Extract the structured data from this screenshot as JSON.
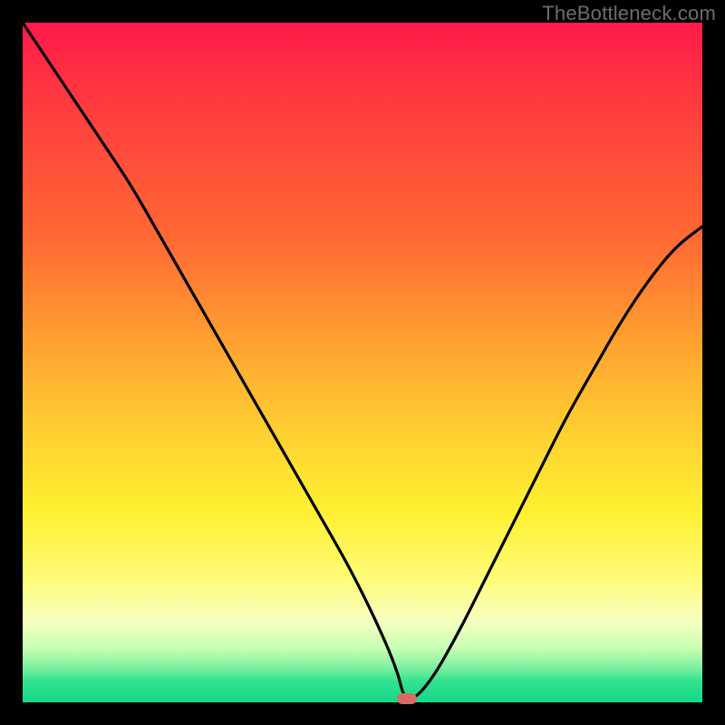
{
  "watermark": "TheBottleneck.com",
  "colors": {
    "frame": "#000000",
    "curve": "#000000",
    "marker": "#d86b64"
  },
  "chart_data": {
    "type": "line",
    "title": "",
    "xlabel": "",
    "ylabel": "",
    "xlim": [
      0,
      100
    ],
    "ylim": [
      0,
      100
    ],
    "grid": false,
    "legend": false,
    "note": "Background vertical gradient encodes severity (red=high, green=low). Curve shows bottleneck % vs. component balance; minimum marks optimal match.",
    "series": [
      {
        "name": "bottleneck-curve",
        "x": [
          0,
          4,
          8,
          12,
          16,
          20,
          24,
          28,
          32,
          36,
          40,
          44,
          48,
          52,
          55,
          56,
          57,
          60,
          64,
          68,
          72,
          76,
          80,
          84,
          88,
          92,
          96,
          100
        ],
        "values": [
          100,
          94,
          88,
          82,
          76,
          69,
          62,
          55,
          48,
          41,
          34,
          27,
          20,
          12,
          5,
          1,
          0,
          3,
          10,
          18,
          26,
          34,
          42,
          49,
          56,
          62,
          67,
          70
        ]
      }
    ],
    "marker": {
      "x": 56.5,
      "y": 0
    }
  }
}
